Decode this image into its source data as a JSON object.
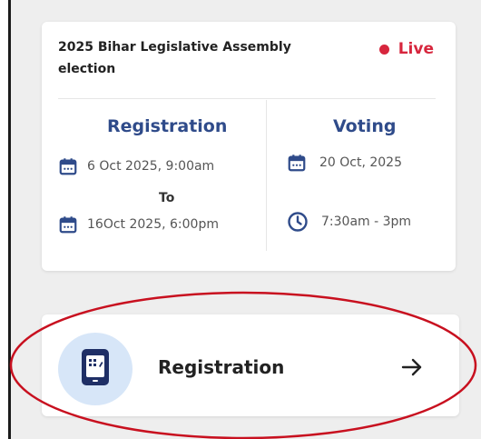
{
  "election": {
    "title": "2025 Bihar Legislative Assembly election",
    "status": "Live"
  },
  "registration": {
    "heading": "Registration",
    "start": "6 Oct 2025, 9:00am",
    "separator": "To",
    "end": "16Oct 2025, 6:00pm"
  },
  "voting": {
    "heading": "Voting",
    "date": "20 Oct, 2025",
    "time": "7:30am - 3pm"
  },
  "action": {
    "label": "Registration"
  },
  "colors": {
    "accent": "#2f4b8a",
    "live": "#d7263d",
    "icon_bg": "#d7e6f8",
    "highlight": "#c8101f"
  },
  "icons": [
    "calendar-icon",
    "clock-icon",
    "phone-form-icon",
    "arrow-right-icon"
  ]
}
